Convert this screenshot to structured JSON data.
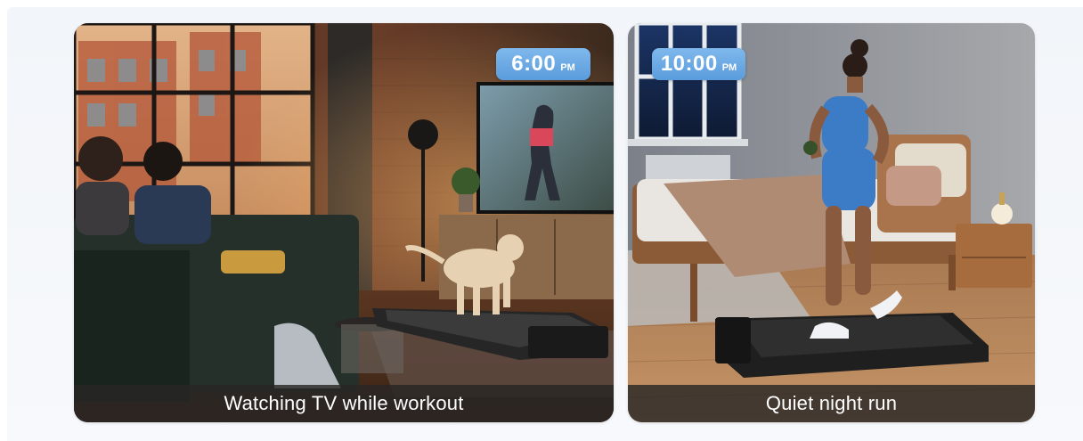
{
  "cards": [
    {
      "time": {
        "value": "6:00",
        "suffix": "PM"
      },
      "caption": "Watching TV while workout"
    },
    {
      "time": {
        "value": "10:00",
        "suffix": "PM"
      },
      "caption": "Quiet night run"
    }
  ],
  "colors": {
    "badge": "#6aa9e4",
    "caption_bar": "#282624",
    "panel": "#f3f6fa"
  }
}
